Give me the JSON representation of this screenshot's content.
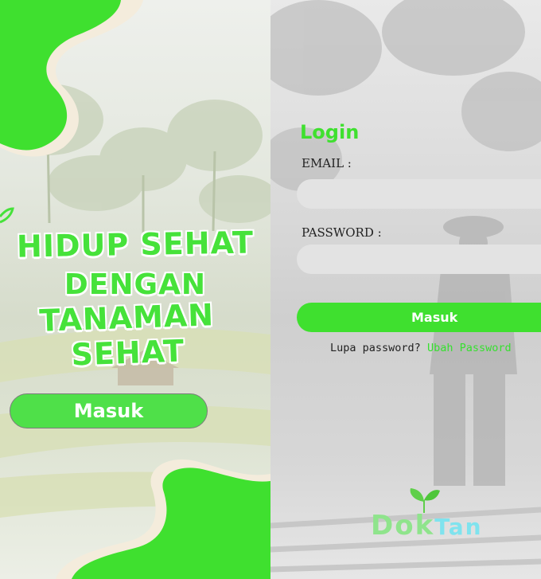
{
  "welcome": {
    "headline": [
      "HIDUP SEHAT",
      "DENGAN",
      "TANAMAN SEHAT"
    ],
    "login_button": "Masuk"
  },
  "login": {
    "title": "Login",
    "email_label": "EMAIL :",
    "email_value": "",
    "password_label": "PASSWORD :",
    "password_value": "",
    "submit_button": "Masuk",
    "forgot_prompt": "Lupa password?",
    "forgot_link": "Ubah Password"
  },
  "brand": {
    "part1": "Dok",
    "part2": "Tan"
  },
  "colors": {
    "accent": "#3fe02f",
    "blob": "#3fe02f",
    "blob_outline": "#f4ecdc",
    "brand_cyan": "#7fe3ee"
  }
}
